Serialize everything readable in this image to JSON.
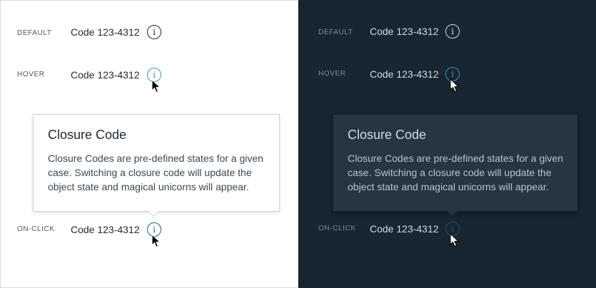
{
  "panels": [
    {
      "theme": "light",
      "states": {
        "default": {
          "label": "DEFAULT",
          "code": "Code 123-4312",
          "icon": "i"
        },
        "hover": {
          "label": "HOVER",
          "code": "Code 123-4312",
          "icon": "i"
        },
        "onclick": {
          "label": "ON-CLICK",
          "code": "Code 123-4312",
          "icon": "i"
        }
      },
      "popover": {
        "title": "Closure Code",
        "body": "Closure Codes are pre-defined states for a given case. Switching a closure code will update the object state and magical unicorns will appear."
      }
    },
    {
      "theme": "dark",
      "states": {
        "default": {
          "label": "DEFAULT",
          "code": "Code 123-4312",
          "icon": "i"
        },
        "hover": {
          "label": "HOVER",
          "code": "Code 123-4312",
          "icon": "i"
        },
        "onclick": {
          "label": "ON-CLICK",
          "code": "Code 123-4312",
          "icon": "i"
        }
      },
      "popover": {
        "title": "Closure Code",
        "body": "Closure Codes are pre-defined states for a given case. Switching a closure code will update the object state and magical unicorns will appear."
      }
    }
  ],
  "colors": {
    "light_bg": "#ffffff",
    "dark_bg": "#172630",
    "hover_accent": "#3b8fd4"
  }
}
